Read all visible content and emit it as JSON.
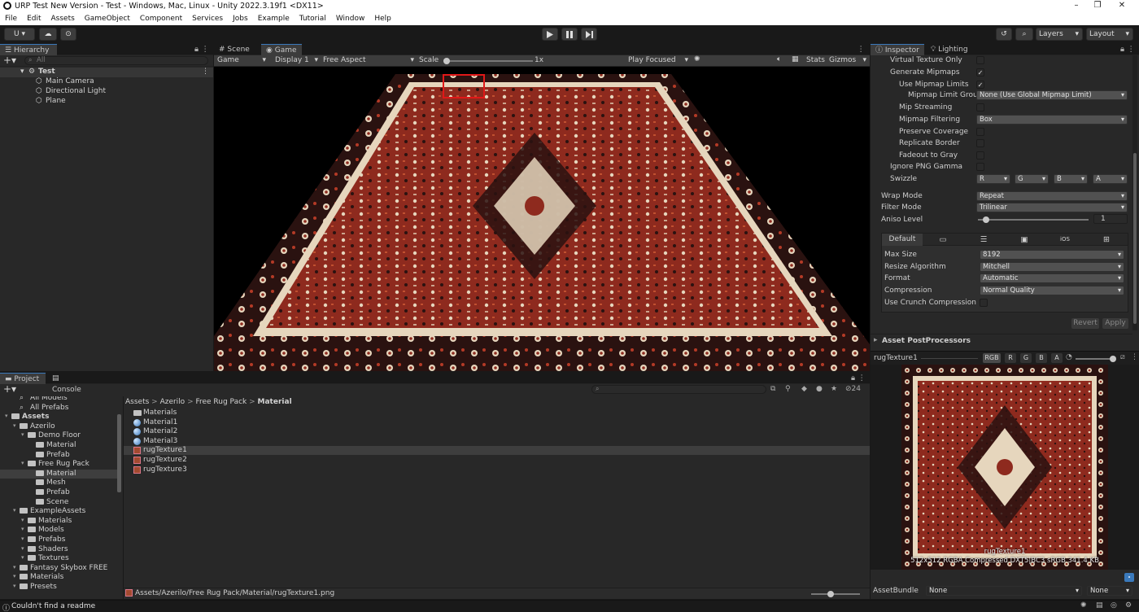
{
  "window": {
    "title": "URP Test New Version - Test - Windows, Mac, Linux - Unity 2022.3.19f1 <DX11>",
    "controls": [
      "–",
      "❐",
      "✕"
    ]
  },
  "menu": [
    "File",
    "Edit",
    "Assets",
    "GameObject",
    "Component",
    "Services",
    "Jobs",
    "Example",
    "Tutorial",
    "Window",
    "Help"
  ],
  "toolbar": {
    "account": "U ▾",
    "layers": "Layers",
    "layout": "Layout",
    "play_icon": "play-icon",
    "pause_icon": "pause-icon",
    "step_icon": "step-icon"
  },
  "hierarchy": {
    "tab": "Hierarchy",
    "search_placeholder": "All",
    "scene": "Test",
    "items": [
      "Main Camera",
      "Directional Light",
      "Plane"
    ]
  },
  "game": {
    "tabs": [
      "Scene",
      "Game"
    ],
    "mode": "Game",
    "display": "Display 1",
    "aspect": "Free Aspect",
    "scale_label": "Scale",
    "scale_value": "1x",
    "play_focused": "Play Focused",
    "stats": "Stats",
    "gizmos": "Gizmos"
  },
  "inspector": {
    "tabs": [
      "Inspector",
      "Lighting"
    ],
    "rows": [
      {
        "label": "Virtual Texture Only",
        "checked": false,
        "indent": 0
      },
      {
        "label": "Generate Mipmaps",
        "checked": true,
        "indent": 0
      },
      {
        "label": "Use Mipmap Limits",
        "checked": true,
        "indent": 1
      }
    ],
    "mipmap_limit_group_label": "Mipmap Limit Group",
    "mipmap_limit_group_value": "None (Use Global Mipmap Limit)",
    "mip_streaming": "Mip Streaming",
    "mipmap_filtering_label": "Mipmap Filtering",
    "mipmap_filtering_value": "Box",
    "preserve_coverage": "Preserve Coverage",
    "replicate_border": "Replicate Border",
    "fadeout_to_gray": "Fadeout to Gray",
    "ignore_png_gamma": "Ignore PNG Gamma",
    "swizzle_label": "Swizzle",
    "swizzle": [
      "R",
      "G",
      "B",
      "A"
    ],
    "wrap_mode_label": "Wrap Mode",
    "wrap_mode_value": "Repeat",
    "filter_mode_label": "Filter Mode",
    "filter_mode_value": "Trilinear",
    "aniso_label": "Aniso Level",
    "aniso_value": "1",
    "aniso_fraction": 0.07,
    "platform_tabs": [
      "Default",
      "",
      "",
      "",
      "iOS",
      ""
    ],
    "max_size_label": "Max Size",
    "max_size_value": "8192",
    "resize_label": "Resize Algorithm",
    "resize_value": "Mitchell",
    "format_label": "Format",
    "format_value": "Automatic",
    "compression_label": "Compression",
    "compression_value": "Normal Quality",
    "crunch_label": "Use Crunch Compression",
    "revert": "Revert",
    "apply": "Apply",
    "postprocessors": "Asset PostProcessors",
    "preview_name": "rugTexture1",
    "preview_channels": [
      "RGB",
      "R",
      "G",
      "B",
      "A"
    ],
    "preview_caption1": "rugTexture1",
    "preview_caption2": "512x512  RGBA Compressed DXT5|BC3 sRGB  341.4 KB",
    "assetbundle_label": "AssetBundle",
    "assetbundle_value": "None",
    "assetbundle_variant": "None"
  },
  "project": {
    "tabs": [
      "Project",
      "Console"
    ],
    "hidden_count": "24",
    "tree": [
      {
        "label": "All Models",
        "indent": 1,
        "icon": "search"
      },
      {
        "label": "All Prefabs",
        "indent": 1,
        "icon": "search"
      },
      {
        "label": "Assets",
        "indent": 0,
        "icon": "folder",
        "bold": true
      },
      {
        "label": "Azerilo",
        "indent": 1,
        "icon": "folder"
      },
      {
        "label": "Demo Floor",
        "indent": 2,
        "icon": "folder"
      },
      {
        "label": "Material",
        "indent": 3,
        "icon": "folder"
      },
      {
        "label": "Prefab",
        "indent": 3,
        "icon": "folder"
      },
      {
        "label": "Free Rug Pack",
        "indent": 2,
        "icon": "folder"
      },
      {
        "label": "Material",
        "indent": 3,
        "icon": "folder",
        "selected": true
      },
      {
        "label": "Mesh",
        "indent": 3,
        "icon": "folder"
      },
      {
        "label": "Prefab",
        "indent": 3,
        "icon": "folder"
      },
      {
        "label": "Scene",
        "indent": 3,
        "icon": "folder"
      },
      {
        "label": "ExampleAssets",
        "indent": 1,
        "icon": "folder"
      },
      {
        "label": "Materials",
        "indent": 2,
        "icon": "folder"
      },
      {
        "label": "Models",
        "indent": 2,
        "icon": "folder"
      },
      {
        "label": "Prefabs",
        "indent": 2,
        "icon": "folder"
      },
      {
        "label": "Shaders",
        "indent": 2,
        "icon": "folder"
      },
      {
        "label": "Textures",
        "indent": 2,
        "icon": "folder"
      },
      {
        "label": "Fantasy Skybox FREE",
        "indent": 1,
        "icon": "folder"
      },
      {
        "label": "Materials",
        "indent": 1,
        "icon": "folder"
      },
      {
        "label": "Presets",
        "indent": 1,
        "icon": "folder"
      }
    ],
    "breadcrumb": [
      "Assets",
      "Azerilo",
      "Free Rug Pack",
      "Material"
    ],
    "files": [
      {
        "label": "Materials",
        "type": "folder"
      },
      {
        "label": "Material1",
        "type": "material"
      },
      {
        "label": "Material2",
        "type": "material"
      },
      {
        "label": "Material3",
        "type": "material"
      },
      {
        "label": "rugTexture1",
        "type": "texture",
        "selected": true
      },
      {
        "label": "rugTexture2",
        "type": "texture"
      },
      {
        "label": "rugTexture3",
        "type": "texture"
      }
    ],
    "path": "Assets/Azerilo/Free Rug Pack/Material/rugTexture1.png"
  },
  "status": {
    "message": "Couldn't find a readme"
  },
  "colors": {
    "accent": "#3a79bb",
    "rug_red": "#8e2a1e",
    "rug_dark": "#2a1210",
    "rug_cream": "#e6d6bd",
    "highlight_box": "#e01818"
  }
}
